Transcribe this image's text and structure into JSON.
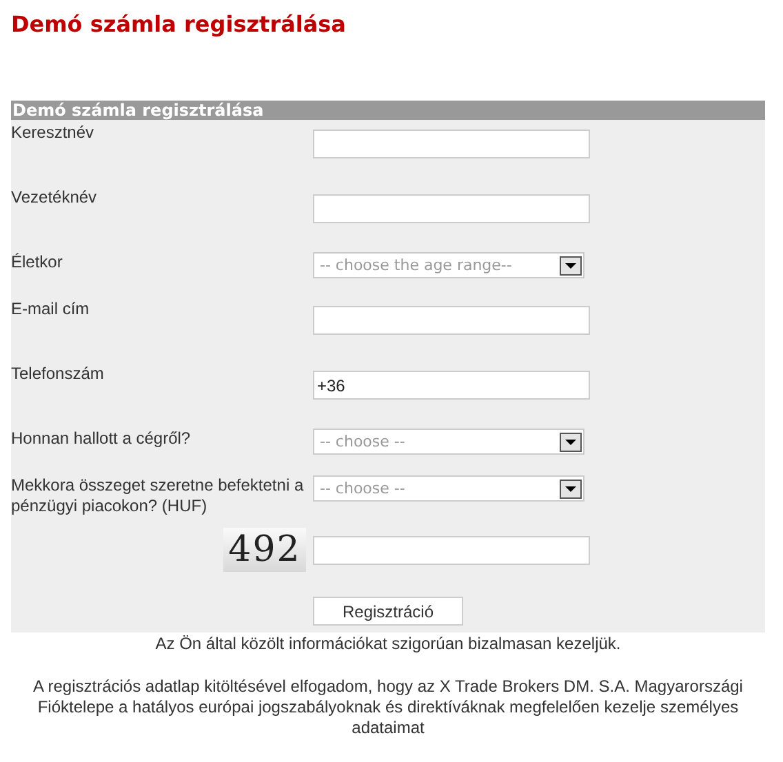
{
  "title": "Demó számla regisztrálása",
  "form": {
    "header": "Demó számla regisztrálása",
    "fields": [
      {
        "kind": "text",
        "label": "Keresztnév"
      },
      {
        "kind": "text",
        "label": "Vezetéknév"
      },
      {
        "kind": "select",
        "label": "Életkor",
        "value": "-- choose the age range--"
      },
      {
        "kind": "text",
        "label": "E-mail cím"
      },
      {
        "kind": "text",
        "label": "Telefonszám",
        "value": "+36"
      },
      {
        "kind": "select",
        "label": "Honnan hallott a cégről?",
        "value": "-- choose --"
      },
      {
        "kind": "select",
        "label": "Mekkora összeget szeretne befektetni a pénzügyi piacokon? (HUF)",
        "value": "-- choose --"
      },
      {
        "kind": "captcha",
        "captcha": "492"
      }
    ],
    "submit": "Regisztráció"
  },
  "notes": [
    "Az Ön által közölt információkat szigorúan bizalmasan kezeljük.",
    "A regisztrációs adatlap kitöltésével elfogadom, hogy az X Trade Brokers DM. S.A. Magyarországi Fióktelepe a hatályos európai jogszabályoknak és direktíváknak megfelelően kezelje személyes adataimat"
  ]
}
